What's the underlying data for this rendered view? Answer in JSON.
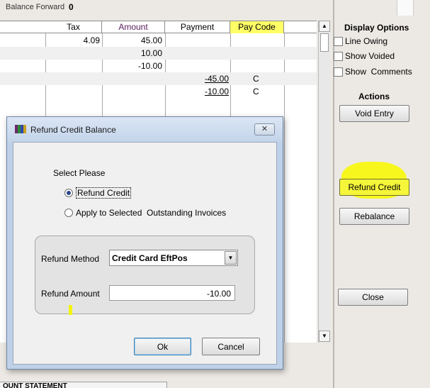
{
  "balance_forward": {
    "label": "Balance Forward",
    "value": "0"
  },
  "grid": {
    "columns": [
      "Tax",
      "Amount",
      "Payment",
      "Pay Code"
    ],
    "rows": [
      {
        "tax": "4.09",
        "amount": "45.00",
        "payment": "",
        "code": ""
      },
      {
        "tax": "",
        "amount": "10.00",
        "payment": "",
        "code": ""
      },
      {
        "tax": "",
        "amount": "-10.00",
        "payment": "",
        "code": ""
      },
      {
        "tax": "",
        "amount": "",
        "payment": "-45.00",
        "code": "C"
      },
      {
        "tax": "",
        "amount": "",
        "payment": "-10.00",
        "code": "C"
      }
    ]
  },
  "display_options": {
    "title": "Display Options",
    "items": [
      "Line Owing",
      "Show Voided",
      "Show  Comments"
    ]
  },
  "actions": {
    "title": "Actions",
    "void_entry": "Void Entry",
    "refund_credit": "Refund Credit",
    "rebalance": "Rebalance",
    "close": "Close"
  },
  "bottom_tab": {
    "label": "OUNT STATEMENT"
  },
  "dialog": {
    "title": "Refund Credit Balance",
    "close_glyph": "✕",
    "prompt": "Select Please",
    "option_refund": "Refund Credit",
    "option_apply": "Apply to Selected  Outstanding Invoices",
    "refund_method_label": "Refund Method",
    "refund_method_value": "Credit Card EftPos",
    "refund_amount_label": "Refund Amount",
    "refund_amount_value": "-10.00",
    "ok": "Ok",
    "cancel": "Cancel"
  },
  "colors": {
    "highlight": "#f7f71e",
    "paycode_header": "#ffff66",
    "titlebar": "#c3d4ea"
  }
}
